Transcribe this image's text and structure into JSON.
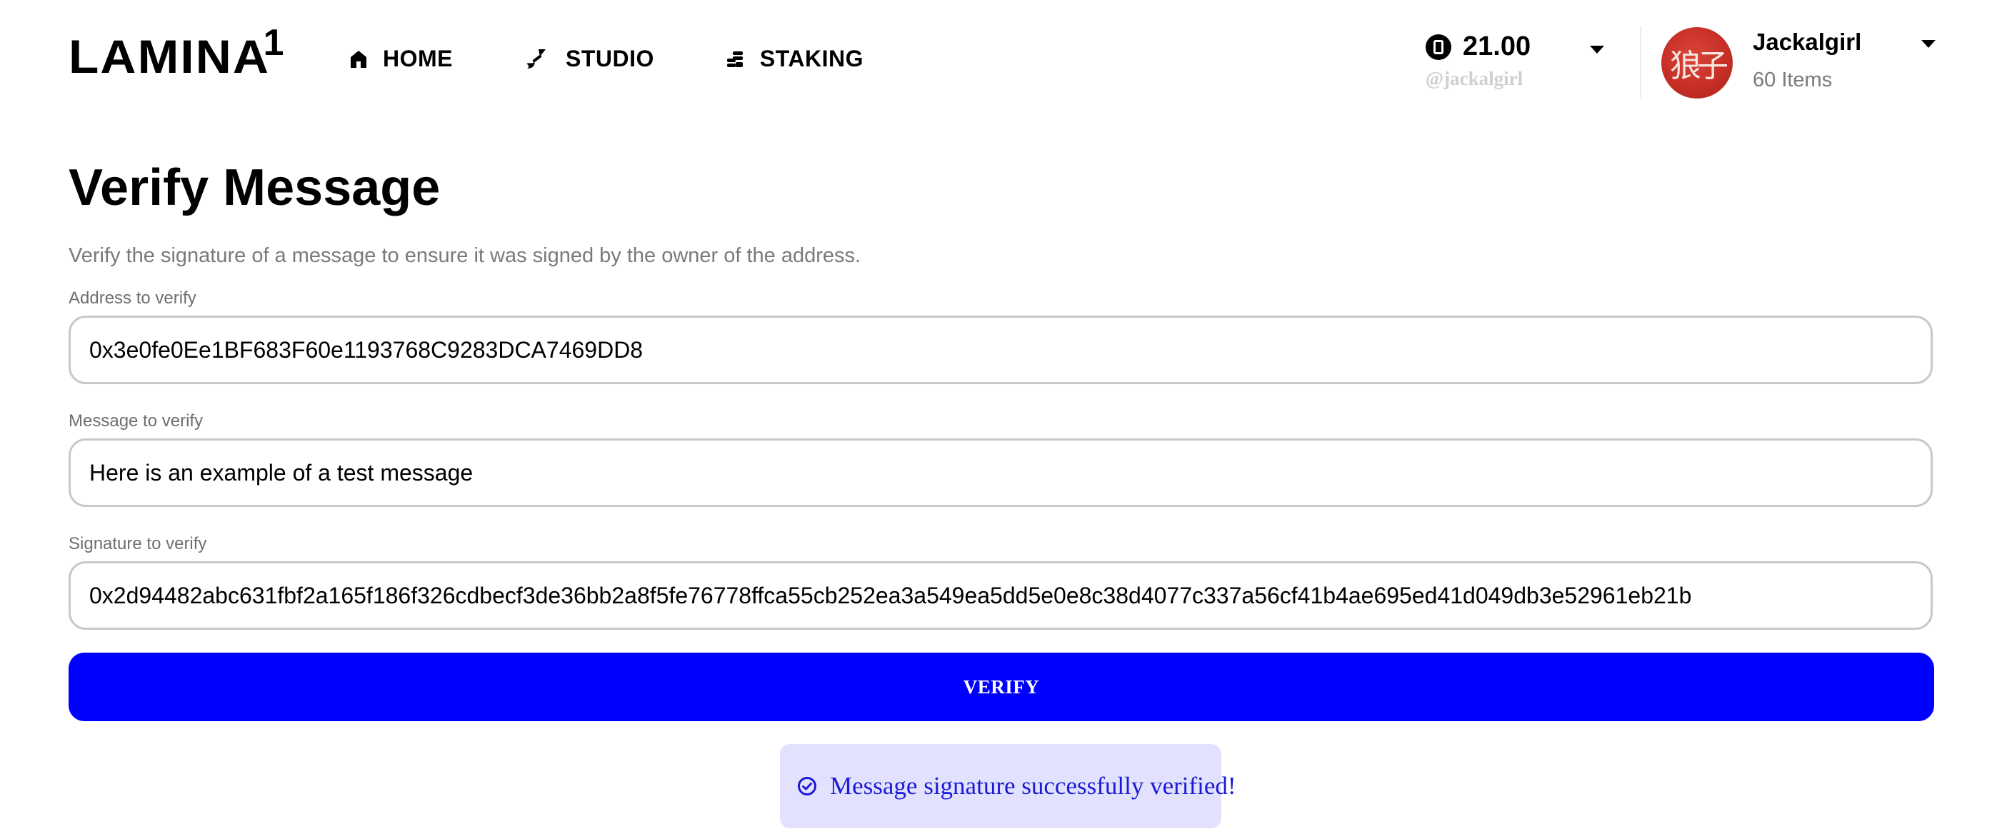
{
  "brand": {
    "logo_text": "LAMINA",
    "logo_suffix": "1"
  },
  "nav": {
    "items": [
      {
        "label": "HOME",
        "icon": "home-icon"
      },
      {
        "label": "STUDIO",
        "icon": "brush-icon"
      },
      {
        "label": "STAKING",
        "icon": "coins-icon"
      }
    ]
  },
  "wallet": {
    "balance": "21.00",
    "handle": "@jackalgirl",
    "icon": "lamina-coin-icon"
  },
  "user": {
    "name": "Jackalgirl",
    "items_count": "60 Items",
    "avatar_glyph": "狼子"
  },
  "main": {
    "title": "Verify Message",
    "description": "Verify the signature of a message to ensure it was signed by the owner of the address.",
    "fields": {
      "address": {
        "label": "Address to verify",
        "value": "0x3e0fe0Ee1BF683F60e1193768C9283DCA7469DD8"
      },
      "message": {
        "label": "Message to verify",
        "value": "Here is an example of a test message"
      },
      "signature": {
        "label": "Signature to verify",
        "value": "0x2d94482abc631fbf2a165f186f326cdbecf3de36bb2a8f5fe76778ffca55cb252ea3a549ea5dd5e0e8c38d4077c337a56cf41b4ae695ed41d049db3e52961eb21b"
      }
    },
    "verify_button": "VERIFY",
    "result_message": "Message signature successfully verified!"
  },
  "colors": {
    "accent": "#0000ff",
    "success_bg": "#e2e2ff",
    "success_text": "#1a1ad6",
    "avatar_red": "#c72f26"
  }
}
